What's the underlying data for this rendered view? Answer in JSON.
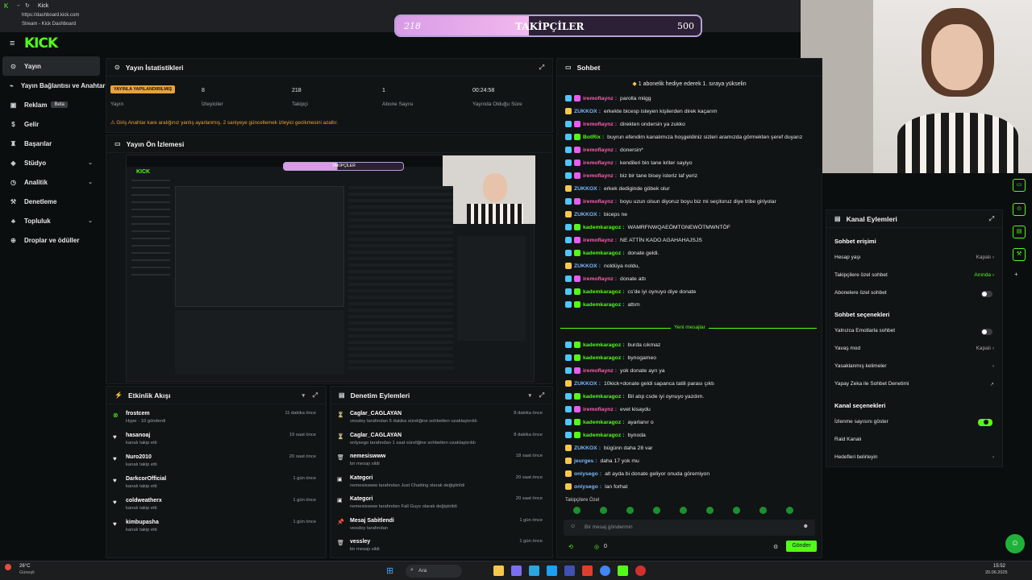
{
  "browser": {
    "tab_title": "Kick",
    "url": "https://dashboard.kick.com",
    "subtitle": "Stream - Kick Dashboard"
  },
  "brand": {
    "logo": "KICK",
    "accent": "#53fc18"
  },
  "follower_goal": {
    "current": "218",
    "label": "TAKİPÇİLER",
    "target": "500",
    "progress": 0.436
  },
  "sidebar": {
    "items": [
      {
        "label": "Yayın",
        "icon": "home-icon"
      },
      {
        "label": "Yayın Bağlantısı ve Anahtarı",
        "icon": "link-icon"
      },
      {
        "label": "Reklam",
        "icon": "ad-icon",
        "badge": "Beta"
      },
      {
        "label": "Gelir",
        "icon": "money-icon"
      },
      {
        "label": "Başarılar",
        "icon": "trophy-icon"
      },
      {
        "label": "Stüdyo",
        "icon": "studio-icon"
      },
      {
        "label": "Analitik",
        "icon": "chart-icon"
      },
      {
        "label": "Denetleme",
        "icon": "shield-icon"
      },
      {
        "label": "Topluluk",
        "icon": "community-icon"
      },
      {
        "label": "Droplar ve ödüller",
        "icon": "gift-icon"
      }
    ]
  },
  "stats": {
    "title": "Yayın İstatistikleri",
    "live_badge": "YAYINLA YAPILANDIRILMIŞ",
    "status_label": "Yayın",
    "viewers": "8",
    "viewers_label": "İzleyiciler",
    "followers": "218",
    "followers_label": "Takipçi",
    "subs": "1",
    "subs_label": "Abone Sayısı",
    "uptime": "00:24:58",
    "uptime_label": "Yayında Olduğu Süre",
    "warning": "Giriş Anahtar kare aralığınız yanlış ayarlanmış. 2 saniyeye güncellemek izleyici gecikmesini azaltır."
  },
  "preview": {
    "title": "Yayın Ön İzlemesi",
    "goal_label": "TAKİPÇİLER"
  },
  "events": {
    "title": "Etkinlik Akışı",
    "rows": [
      {
        "name": "frostcem",
        "sub": "Hype · 10 gönderdi",
        "time": "11 dakika önce"
      },
      {
        "name": "hasanoaj",
        "sub": "kanalı takip etti",
        "time": "19 saat önce"
      },
      {
        "name": "Nuro2010",
        "sub": "kanalı takip etti",
        "time": "20 saat önce"
      },
      {
        "name": "DarkcorOfficial",
        "sub": "kanalı takip etti",
        "time": "1 gün önce"
      },
      {
        "name": "coldweatherx",
        "sub": "kanalı takip etti",
        "time": "1 gün önce"
      },
      {
        "name": "kimbupasha",
        "sub": "kanalı takip etti",
        "time": "1 gün önce"
      }
    ]
  },
  "moderation": {
    "title": "Denetim Eylemleri",
    "rows": [
      {
        "name": "Caglar_CAGLAYAN",
        "sub": "vessley tarafından 5 dakika süreliğine sohbetten uzaklaştırıldı",
        "time": "8 dakika önce"
      },
      {
        "name": "Caglar_CAGLAYAN",
        "sub": "onlysego tarafından 1 saat süreliğine sohbetten uzaklaştırıldı",
        "time": "8 dakika önce"
      },
      {
        "name": "nemesiswww",
        "sub": "bir mesajı sildi",
        "time": "18 saat önce"
      },
      {
        "name": "Kategori",
        "sub": "nemesiswww tarafından Just Chatting olarak değiştirildi",
        "time": "20 saat önce"
      },
      {
        "name": "Kategori",
        "sub": "nemesiswww tarafından Fall Guys olarak değiştirildi",
        "time": "20 saat önce"
      },
      {
        "name": "Mesaj Sabitlendi",
        "sub": "vessley tarafından",
        "time": "1 gün önce"
      },
      {
        "name": "vessley",
        "sub": "bir mesajı sildi",
        "time": "1 gün önce"
      }
    ]
  },
  "chat": {
    "title": "Sohbet",
    "pinned": "1 abonelik hediye ederek 1. sıraya yükselin",
    "lines": [
      {
        "user": "iremoflaynz",
        "color": "pink",
        "msg": "parolla miigg"
      },
      {
        "user": "ZUKKOX",
        "color": "blue",
        "msg": "erkekte bicesp isteyen kişilerden direk kaçarım"
      },
      {
        "user": "iremoflaynz",
        "color": "pink",
        "msg": "direkten ondersin ya zukko"
      },
      {
        "user": "BotRix",
        "color": "green",
        "msg": "buyrun efendim kanalımıza hoşgeldiniz sizleri aramızda görmekten şeref duyarız"
      },
      {
        "user": "iremoflaynz",
        "color": "pink",
        "msg": "donersin*"
      },
      {
        "user": "iremoflaynz",
        "color": "pink",
        "msg": "kendileri bin tane kriter sayiyo"
      },
      {
        "user": "iremoflaynz",
        "color": "pink",
        "msg": "biz bir tane bisey isteriz laf yeriz"
      },
      {
        "user": "ZUKKOX",
        "color": "blue",
        "msg": "erkek dediginde göbek olur"
      },
      {
        "user": "iremoflaynz",
        "color": "pink",
        "msg": "boyu uzun olsun diyoruz boyu biz mi seçitoruz diye tribe giriyolar"
      },
      {
        "user": "ZUKKOX",
        "color": "blue",
        "msg": "biceps ne"
      },
      {
        "user": "kademkaragoz",
        "color": "green",
        "msg": "WAMRFNWQAEÖMTGNEWÖTMWNTÖF"
      },
      {
        "user": "iremoflaynz",
        "color": "pink",
        "msg": "NE ATTİN KADO AGAHAHAJSJS"
      },
      {
        "user": "kademkaragoz",
        "color": "green",
        "msg": "donate geldi."
      },
      {
        "user": "ZUKKOX",
        "color": "blue",
        "msg": "noldüya noldu,"
      },
      {
        "user": "iremoflaynz",
        "color": "pink",
        "msg": "donate attı"
      },
      {
        "user": "kademkaragoz",
        "color": "green",
        "msg": "cs'de iyi oynuyo diye donate"
      },
      {
        "user": "kademkaragoz",
        "color": "green",
        "msg": "attım"
      }
    ],
    "new_messages": "Yeni mesajlar",
    "lines2": [
      {
        "user": "kademkaragoz",
        "color": "green",
        "msg": "burda cıkmaz"
      },
      {
        "user": "kademkaragoz",
        "color": "green",
        "msg": "bynogameo"
      },
      {
        "user": "iremoflaynz",
        "color": "pink",
        "msg": "yok donate ayrı ya"
      },
      {
        "user": "ZUKKOX",
        "color": "blue",
        "msg": "10kick+donate geldi sapanca tatili parası çıktı"
      },
      {
        "user": "kademkaragoz",
        "color": "green",
        "msg": "Bil atıp csde iyi oynuyo yazdım."
      },
      {
        "user": "iremoflaynz",
        "color": "pink",
        "msg": "evet kisaydu"
      },
      {
        "user": "kademkaragoz",
        "color": "green",
        "msg": "ayarlanır o"
      },
      {
        "user": "kademkaragoz",
        "color": "green",
        "msg": "bynoda"
      },
      {
        "user": "ZUKKOX",
        "color": "blue",
        "msg": "bügünn daha 28 var"
      },
      {
        "user": "jeurges",
        "color": "blue",
        "msg": "daha 17 yok mu"
      },
      {
        "user": "onlysego",
        "color": "blue",
        "msg": "alt ayda bi donate geliyor onuda göremiyon"
      },
      {
        "user": "onlysego",
        "color": "blue",
        "msg": "lan forhat"
      }
    ],
    "followers_only": "Takipçilere Özel",
    "placeholder": "Bir mesaj göndermin",
    "count": "0",
    "send": "Gönder"
  },
  "channel_actions": {
    "title": "Kanal Eylemleri",
    "chat_access": "Sohbet erişimi",
    "rows_a": [
      {
        "label": "Hesap yaşı",
        "value": "Kapalı"
      },
      {
        "label": "Takipçilere özel sohbet",
        "value": "Anında"
      },
      {
        "label": "Abonelere özel sohbet",
        "value": ""
      }
    ],
    "chat_options": "Sohbet seçenekleri",
    "rows_b": [
      {
        "label": "Yalnızca Emotlarla sohbet",
        "value": ""
      },
      {
        "label": "Yavaş mod",
        "value": "Kapalı"
      },
      {
        "label": "Yasaklanmış kelimeler",
        "value": ""
      },
      {
        "label": "Yapay Zeka ile Sohbet Denetimi",
        "value": ""
      }
    ],
    "channel_options": "Kanal seçenekleri",
    "rows_c": [
      {
        "label": "İzlenme sayısını göster",
        "value": ""
      },
      {
        "label": "Raid Kanalı",
        "value": ""
      },
      {
        "label": "Hedefleri belirleyin",
        "value": ""
      }
    ]
  },
  "taskbar": {
    "weather": "26°C",
    "weather_sub": "Güneşli",
    "search": "Ara",
    "time": "15:52",
    "date": "20.06.2025"
  }
}
